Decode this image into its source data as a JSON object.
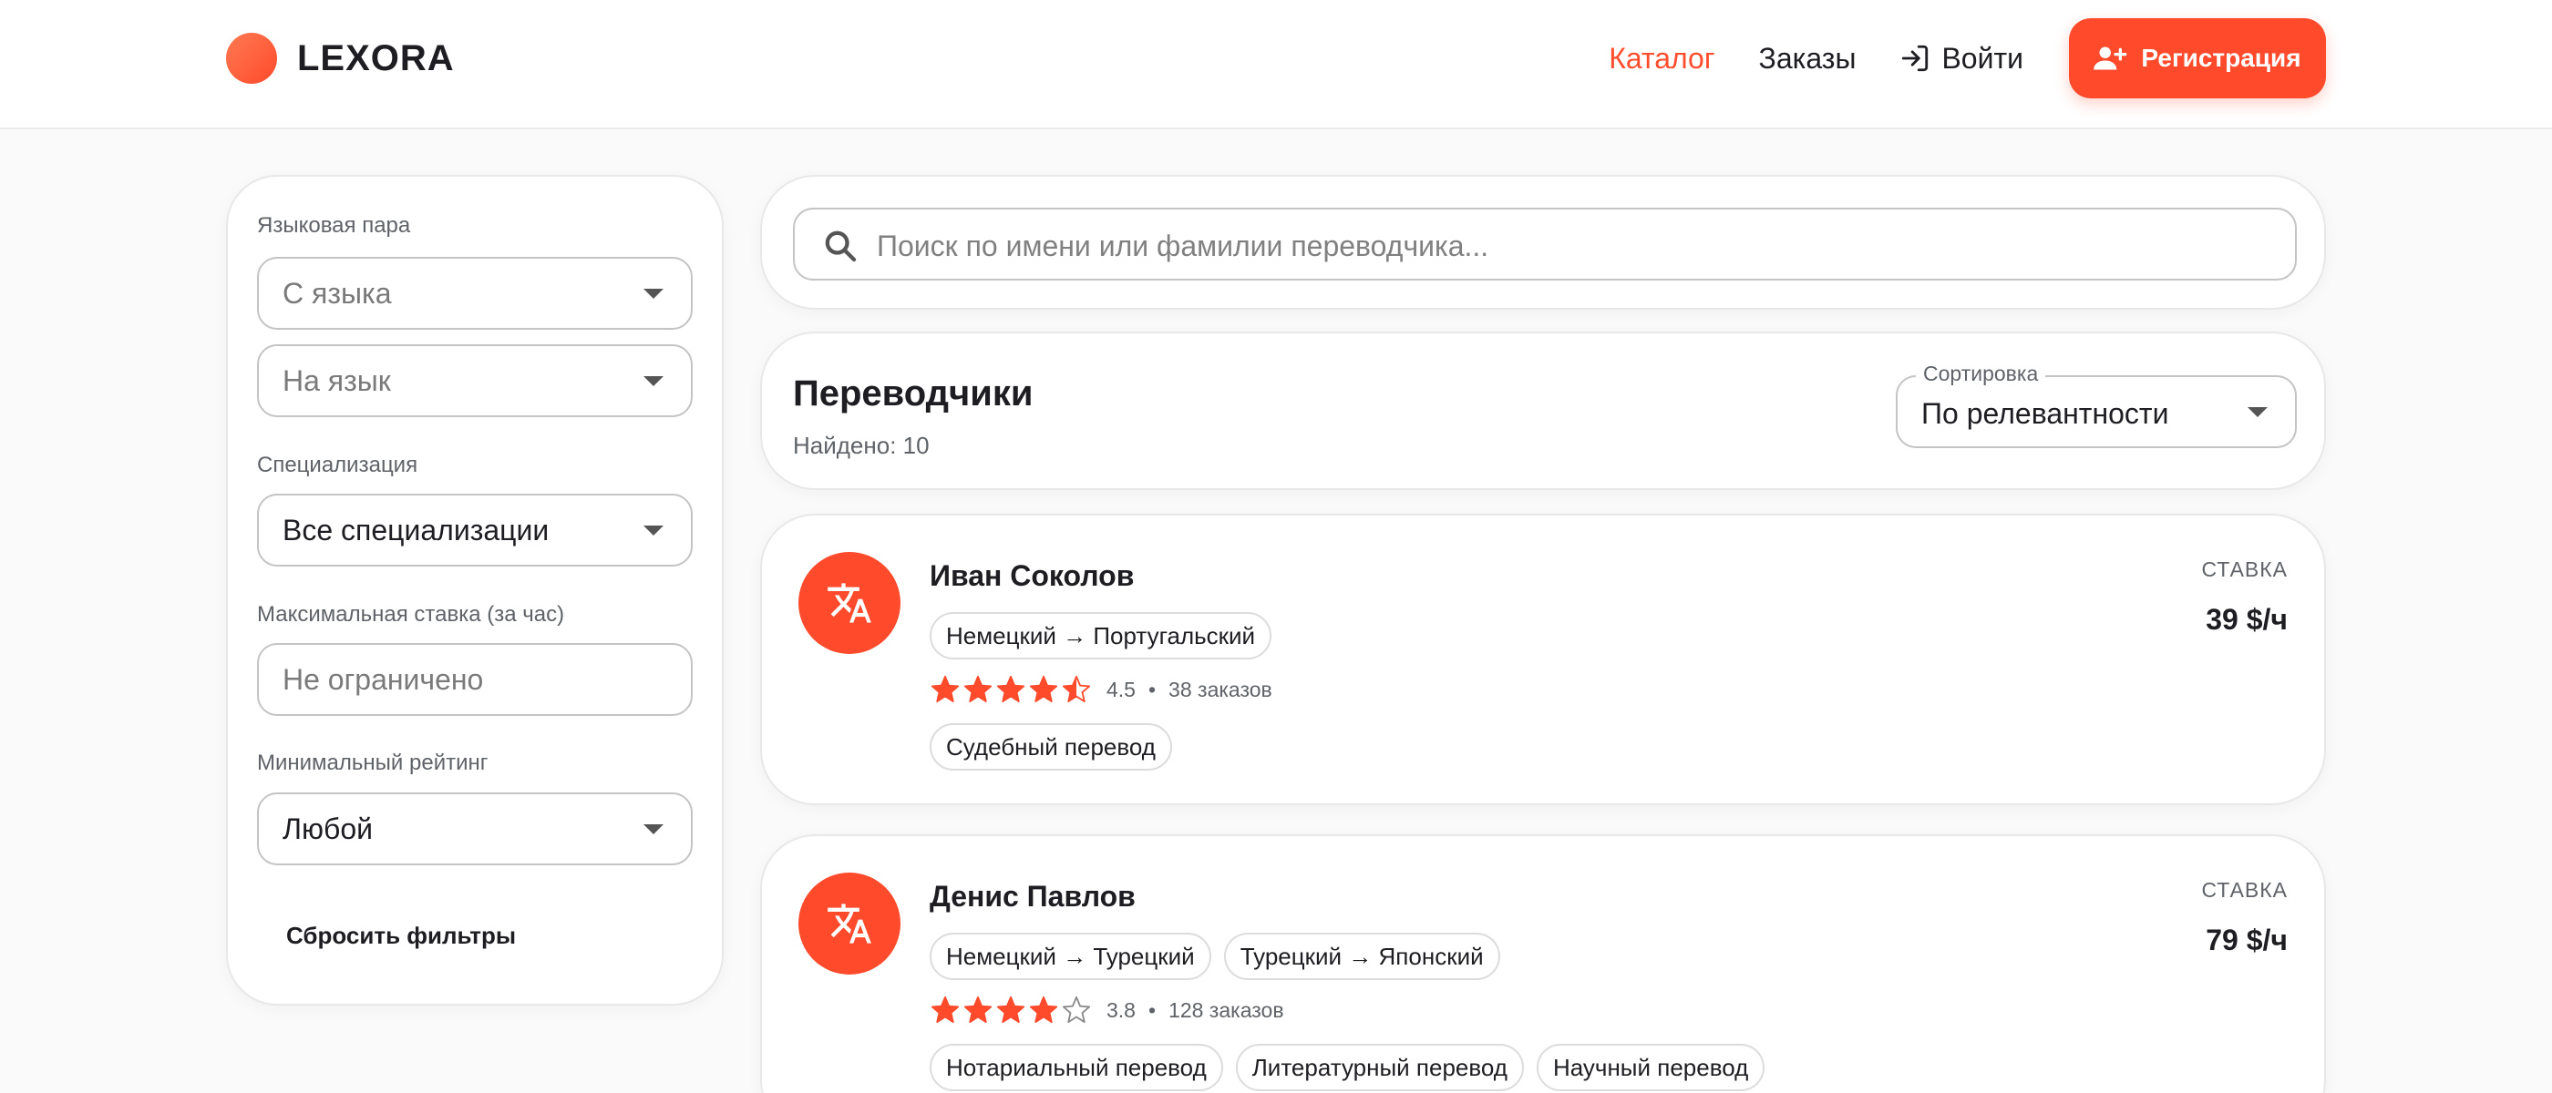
{
  "brand": {
    "name": "LEXORA",
    "color": "#ff4a2c"
  },
  "nav": {
    "catalog": "Каталог",
    "orders": "Заказы",
    "login": "Войти",
    "register": "Регистрация"
  },
  "filters": {
    "language_pair_label": "Языковая пара",
    "from_placeholder": "С языка",
    "to_placeholder": "На язык",
    "specialization_label": "Специализация",
    "specialization_value": "Все специализации",
    "max_rate_label": "Максимальная ставка (за час)",
    "max_rate_placeholder": "Не ограничено",
    "min_rating_label": "Минимальный рейтинг",
    "min_rating_value": "Любой",
    "reset": "Сбросить фильтры"
  },
  "search": {
    "placeholder": "Поиск по имени или фамилии переводчика..."
  },
  "results": {
    "title": "Переводчики",
    "count": "Найдено: 10",
    "sort_label": "Сортировка",
    "sort_value": "По релевантности"
  },
  "translators": [
    {
      "name": "Иван Соколов",
      "pairs": [
        "Немецкий → Португальский"
      ],
      "rating": 4.5,
      "rating_text": "4.5",
      "orders": "38 заказов",
      "specializations": [
        "Судебный перевод"
      ],
      "rate_label": "СТАВКА",
      "rate": "39 $/ч"
    },
    {
      "name": "Денис Павлов",
      "pairs": [
        "Немецкий → Турецкий",
        "Турецкий → Японский"
      ],
      "rating": 3.8,
      "rating_text": "3.8",
      "orders": "128 заказов",
      "specializations": [
        "Нотариальный перевод",
        "Литературный перевод",
        "Научный перевод"
      ],
      "rate_label": "СТАВКА",
      "rate": "79 $/ч"
    }
  ],
  "icons": {
    "brand": "logo-circle",
    "login": "login-arrow-icon",
    "register": "person-add-icon",
    "search": "search-icon",
    "avatar": "translate-icon",
    "star": "star-icon"
  }
}
